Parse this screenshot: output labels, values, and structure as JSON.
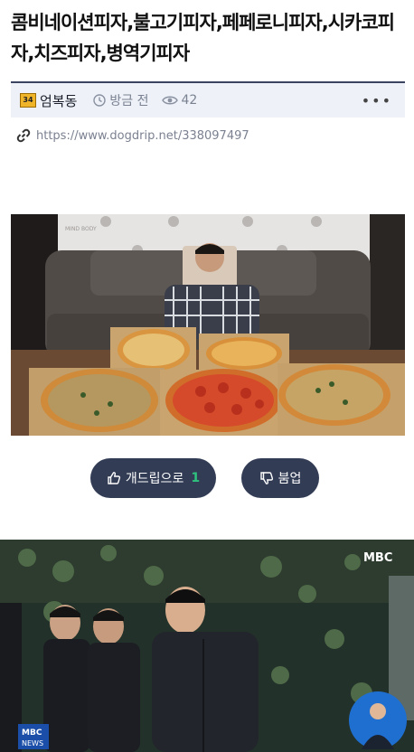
{
  "post": {
    "title": "콤비네이션피자,불고기피자,페페로니피자,시카코피자,치즈피자,병역기피자",
    "board_badge": "34",
    "author": "엄복동",
    "time": "방금 전",
    "views": "42",
    "more": "•••",
    "url": "https://www.dogdrip.net/338097497"
  },
  "vote": {
    "up_label": "개드립으로",
    "up_count": "1",
    "down_label": "붐업"
  },
  "images": {
    "backdrop_brand": "MIND BODY",
    "broadcaster": "MBC",
    "broadcaster_news": "NEWS"
  },
  "colors": {
    "button_bg": "#323c55",
    "vote_count": "#2ec27e",
    "meta_bar_bg": "#eef1f7",
    "meta_bar_border": "#3a4460"
  }
}
